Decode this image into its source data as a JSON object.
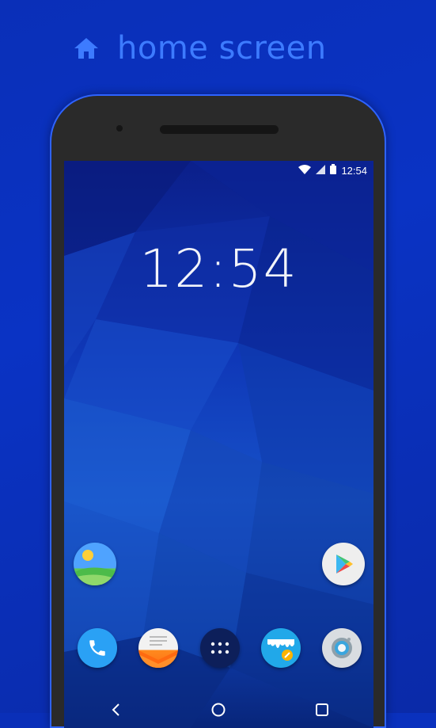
{
  "header": {
    "title": "home screen",
    "icon": "home-icon"
  },
  "status_bar": {
    "time": "12:54",
    "icons": [
      "wifi-icon",
      "signal-icon",
      "battery-icon"
    ]
  },
  "clock": {
    "time": "12:54"
  },
  "home_apps": [
    {
      "name": "gallery-app-icon"
    },
    {
      "name": "play-store-app-icon"
    }
  ],
  "dock_apps": [
    {
      "name": "phone-app-icon"
    },
    {
      "name": "messages-app-icon"
    },
    {
      "name": "app-drawer-icon"
    },
    {
      "name": "paint-app-icon"
    },
    {
      "name": "camera-app-icon"
    }
  ],
  "navbar": {
    "icons": [
      "back-icon",
      "home-nav-icon",
      "recents-icon"
    ]
  },
  "colors": {
    "accent": "#3d7bff",
    "background": "#0a2fb8",
    "phone_frame": "#2a2a2a"
  }
}
